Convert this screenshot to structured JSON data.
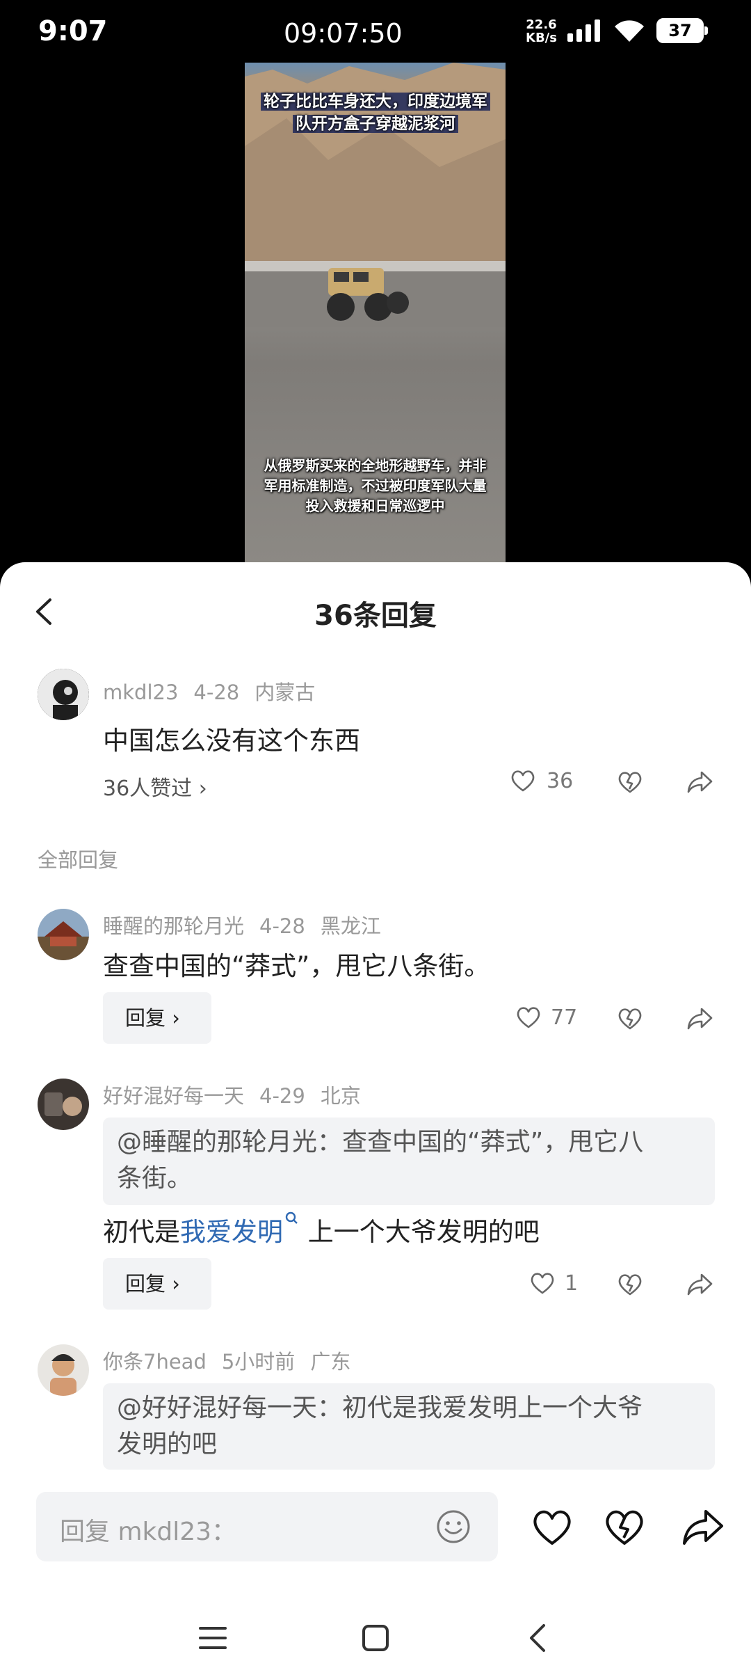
{
  "status_bar": {
    "time": "9:07",
    "clock": "09:07:50",
    "net_speed_value": "22.6",
    "net_speed_unit": "KB/s",
    "battery": "37"
  },
  "video": {
    "caption_top_line1": "轮子比比车身还大，印度边境军",
    "caption_top_line2": "队开方盒子穿越泥浆河",
    "caption_bottom_line1": "从俄罗斯买来的全地形越野车，并非",
    "caption_bottom_line2": "军用标准制造，不过被印度军队大量",
    "caption_bottom_line3": "投入救援和日常巡逻中"
  },
  "sheet": {
    "title": "36条回复",
    "main_comment": {
      "user": "mkdl23",
      "date": "4-28",
      "location": "内蒙古",
      "text": "中国怎么没有这个东西",
      "likes_link": "36人赞过 ›",
      "like_count": "36"
    },
    "section_label": "全部回复",
    "replies": [
      {
        "user": "睡醒的那轮月光",
        "date": "4-28",
        "location": "黑龙江",
        "text": "查查中国的“莽式”，甩它八条街。",
        "reply_label": "回复 ›",
        "like_count": "77"
      },
      {
        "user": "好好混好每一天",
        "date": "4-29",
        "location": "北京",
        "quote_line1": "@睡醒的那轮月光：查查中国的“莽式”，甩它八",
        "quote_line2": "条街。",
        "text_prefix": "初代是",
        "text_link": "我爱发明",
        "text_suffix": " 上一个大爷发明的吧",
        "reply_label": "回复 ›",
        "like_count": "1"
      },
      {
        "user": "你条7head",
        "date": "5小时前",
        "location": "广东",
        "quote_line1": "@好好混好每一天：初代是我爱发明上一个大爷",
        "quote_line2": "发明的吧"
      }
    ]
  },
  "input": {
    "placeholder": "回复 mkdl23："
  },
  "colors": {
    "link": "#2f69b3",
    "muted": "#999999",
    "panel": "#f2f3f5"
  }
}
